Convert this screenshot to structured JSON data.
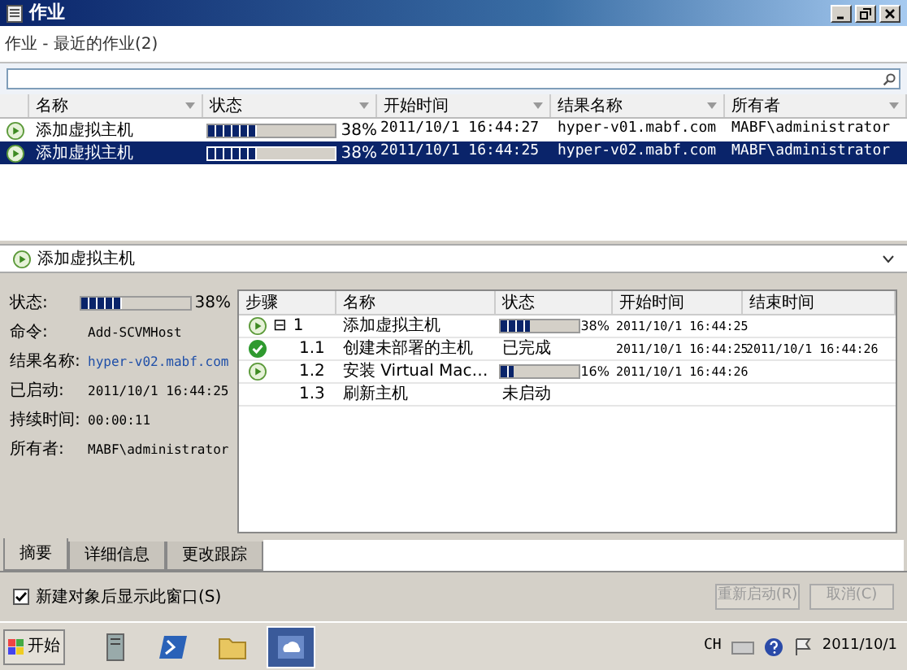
{
  "window": {
    "title": "作业"
  },
  "breadcrumb": "作业 - 最近的作业(2)",
  "jobs": {
    "columns": [
      "名称",
      "状态",
      "开始时间",
      "结果名称",
      "所有者"
    ],
    "rows": [
      {
        "kind": "running",
        "name": "添加虚拟主机",
        "level": 0.38,
        "reading": "38%",
        "start": "2011/10/1 16:44:27",
        "result": "hyper-v01.mabf.com",
        "owner": "MABF\\administrator",
        "selected": false
      },
      {
        "kind": "running",
        "name": "添加虚拟主机",
        "level": 0.38,
        "reading": "38%",
        "start": "2011/10/1 16:44:25",
        "result": "hyper-v02.mabf.com",
        "owner": "MABF\\administrator",
        "selected": true
      }
    ]
  },
  "detail_title": "添加虚拟主机",
  "summary": {
    "status_label": "状态:",
    "level": 0.38,
    "reading": "38%",
    "fields": [
      {
        "label": "命令:",
        "value": "Add-SCVMHost",
        "kind": "text"
      },
      {
        "label": "结果名称:",
        "value": "hyper-v02.mabf.com",
        "kind": "link"
      },
      {
        "label": "已启动:",
        "value": "2011/10/1 16:44:25",
        "kind": "text"
      },
      {
        "label": "持续时间:",
        "value": "00:00:11",
        "kind": "text"
      },
      {
        "label": "所有者:",
        "value": "MABF\\administrator",
        "kind": "text"
      }
    ]
  },
  "steps": {
    "columns": [
      "步骤",
      "名称",
      "状态",
      "开始时间",
      "结束时间"
    ],
    "rows": [
      {
        "kind": "running",
        "toggle": "⊟",
        "step": "1",
        "name": "添加虚拟主机",
        "level": 0.38,
        "reading": "38%",
        "start": "2011/10/1 16:44:25",
        "expanded": true,
        "children": [
          {
            "kind": "done",
            "step": "1.1",
            "name": "创建未部署的主机",
            "status": "已完成",
            "start": "2011/10/1 16:44:25",
            "end": "2011/10/1 16:44:26"
          },
          {
            "kind": "running",
            "step": "1.2",
            "name": "安装 Virtual Mac…",
            "level": 0.16,
            "reading": "16%",
            "start": "2011/10/1 16:44:26"
          },
          {
            "kind": "pending",
            "step": "1.3",
            "name": "刷新主机",
            "status": "未启动"
          }
        ]
      }
    ]
  },
  "tabs": [
    {
      "label": "摘要",
      "selected": true
    },
    {
      "label": "详细信息",
      "selected": false
    },
    {
      "label": "更改跟踪",
      "selected": false
    }
  ],
  "show_window_option": {
    "label": "新建对象后显示此窗口(S)",
    "checked": true
  },
  "buttons": [
    {
      "label": "重新启动(R)",
      "disabled": true
    },
    {
      "label": "取消(C)",
      "disabled": true
    }
  ],
  "taskbar": {
    "start": "开始",
    "language": "CH",
    "clock": "2011/10/1"
  }
}
